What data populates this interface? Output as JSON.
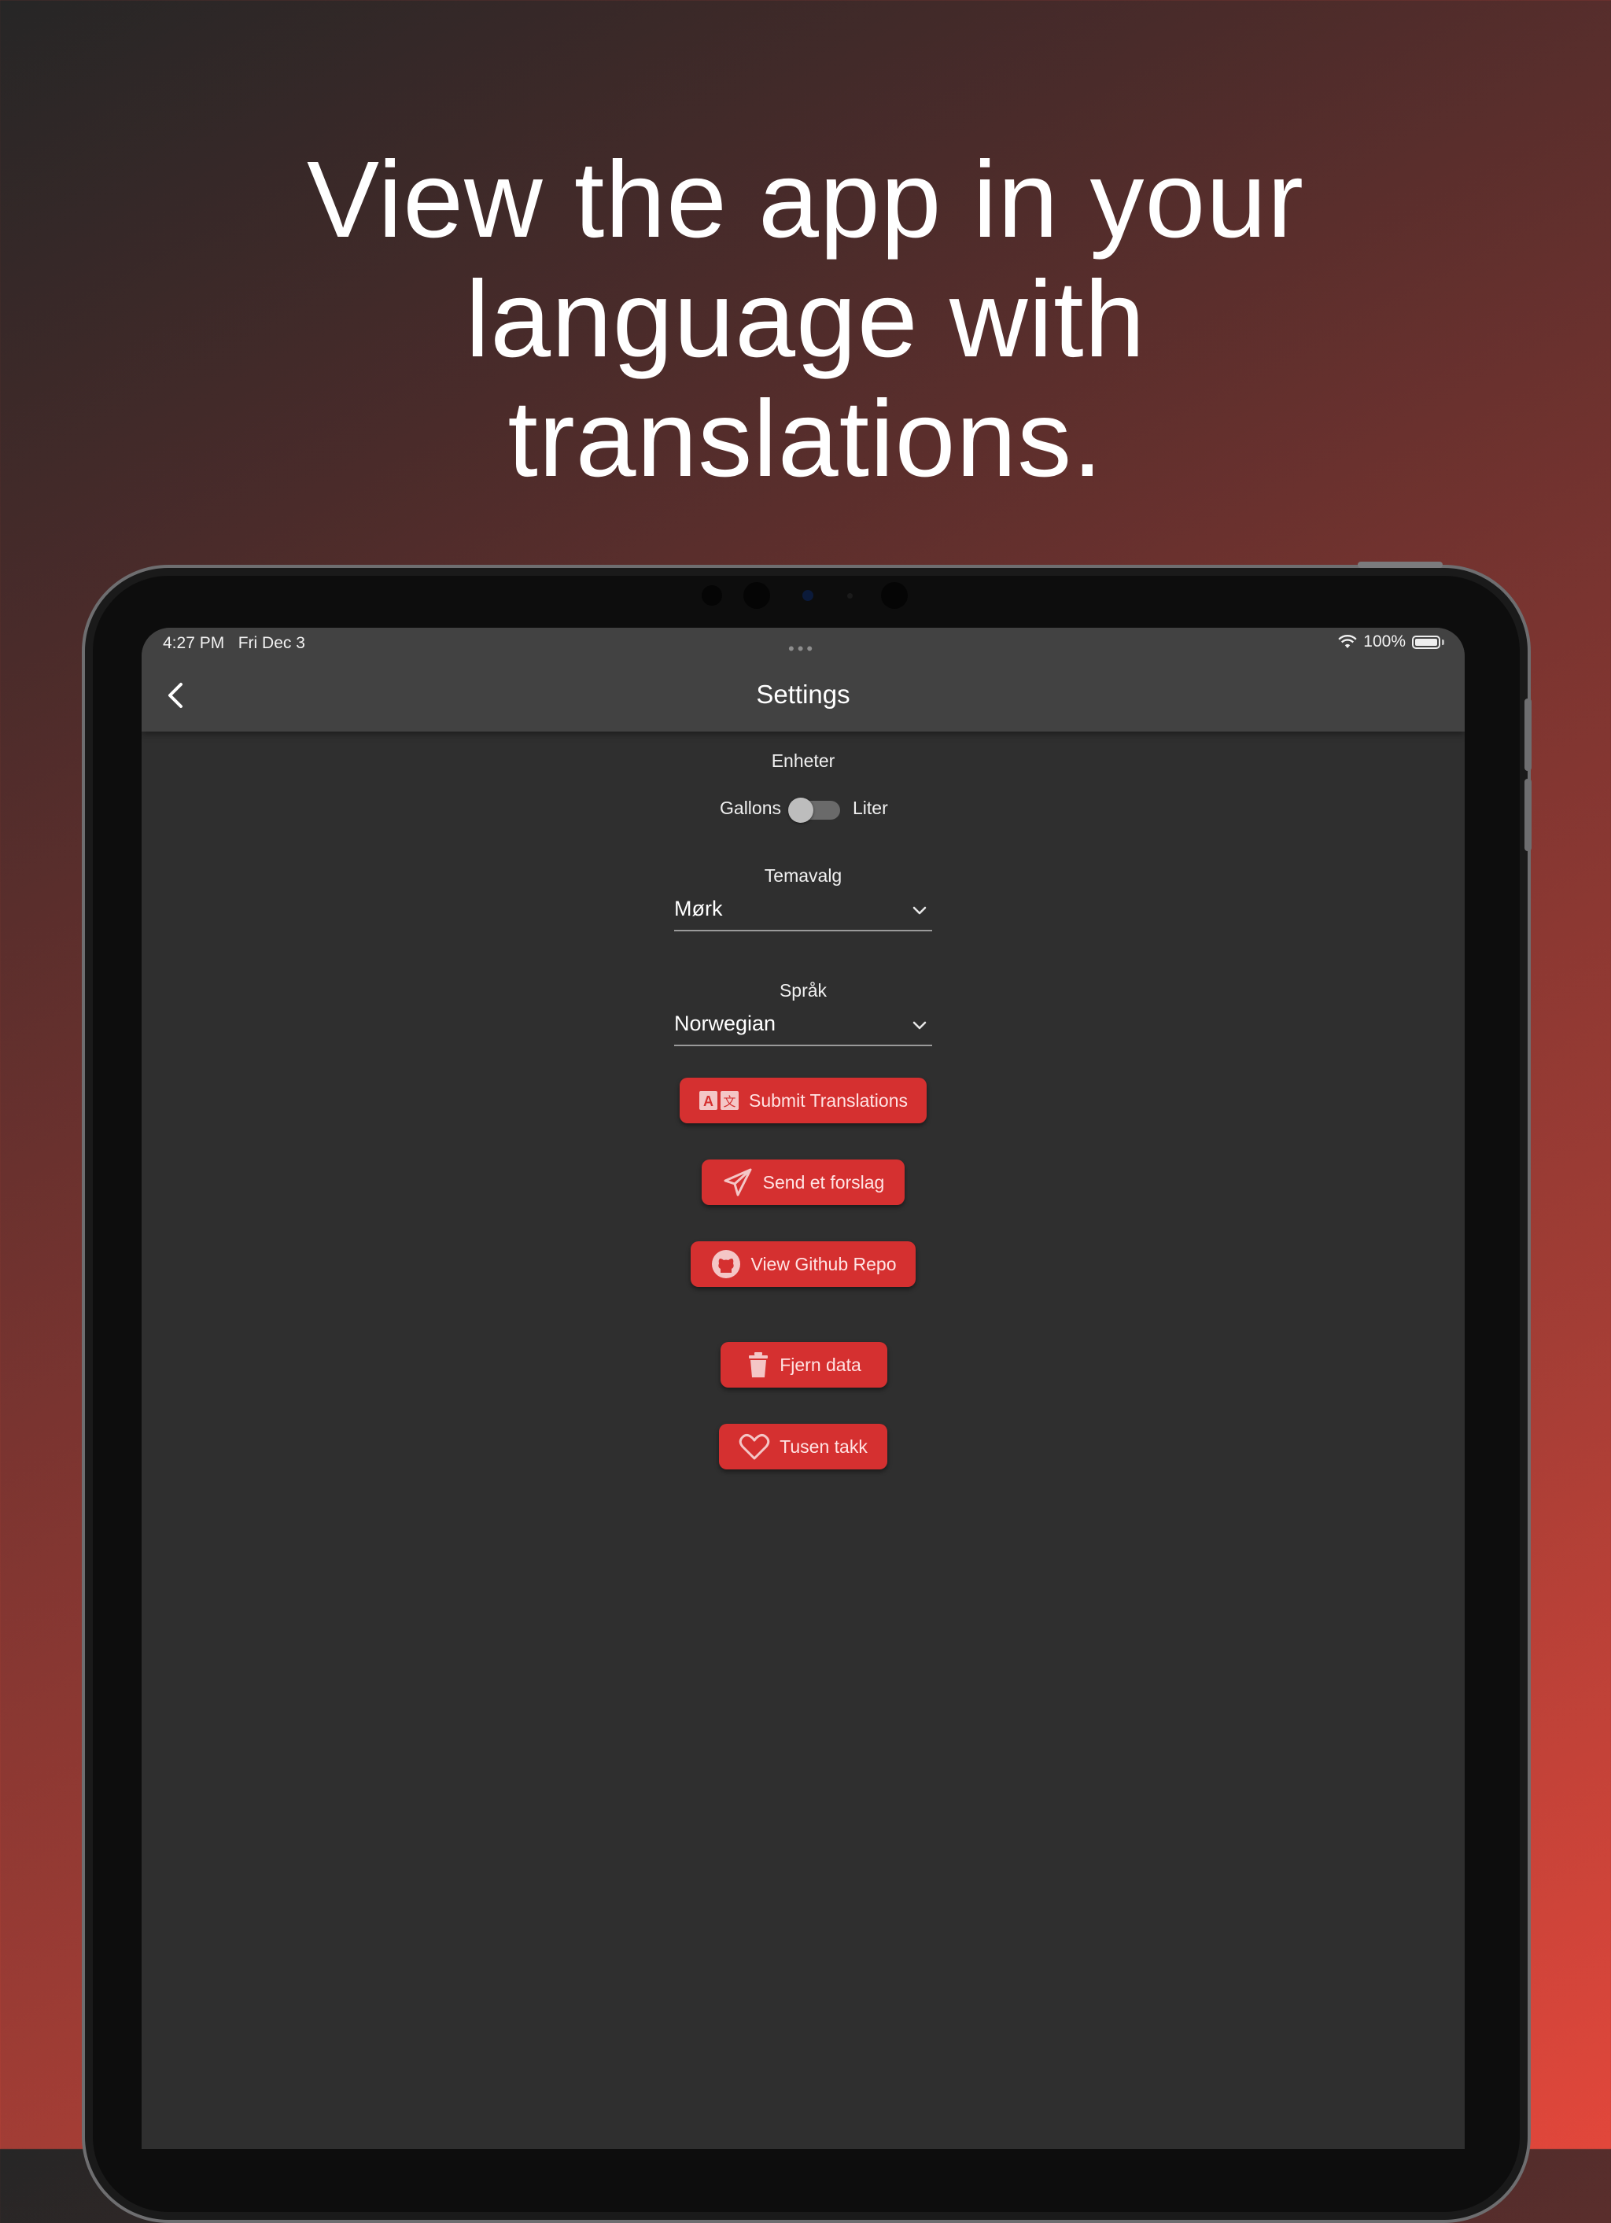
{
  "headline": {
    "line1": "View the app in your",
    "line2": "language with",
    "line3": "translations."
  },
  "status_bar": {
    "time": "4:27 PM",
    "date": "Fri Dec 3",
    "dots": "•••",
    "battery_text": "100%",
    "battery_level": 1.0
  },
  "appbar": {
    "title": "Settings",
    "back_icon": "chevron-left-icon"
  },
  "units": {
    "label": "Enheter",
    "left_option": "Gallons",
    "right_option": "Liter",
    "toggle_on": false
  },
  "theme": {
    "label": "Temavalg",
    "selected": "Mørk"
  },
  "language": {
    "label": "Språk",
    "selected": "Norwegian"
  },
  "buttons": {
    "submit_translations": "Submit Translations",
    "send_suggestion": "Send et forslag",
    "github_repo": "View Github Repo",
    "remove_data": "Fjern data",
    "thanks": "Tusen takk"
  },
  "colors": {
    "accent": "#d53030",
    "screen_bg": "#2f2f2f",
    "appbar_bg": "#424242"
  }
}
